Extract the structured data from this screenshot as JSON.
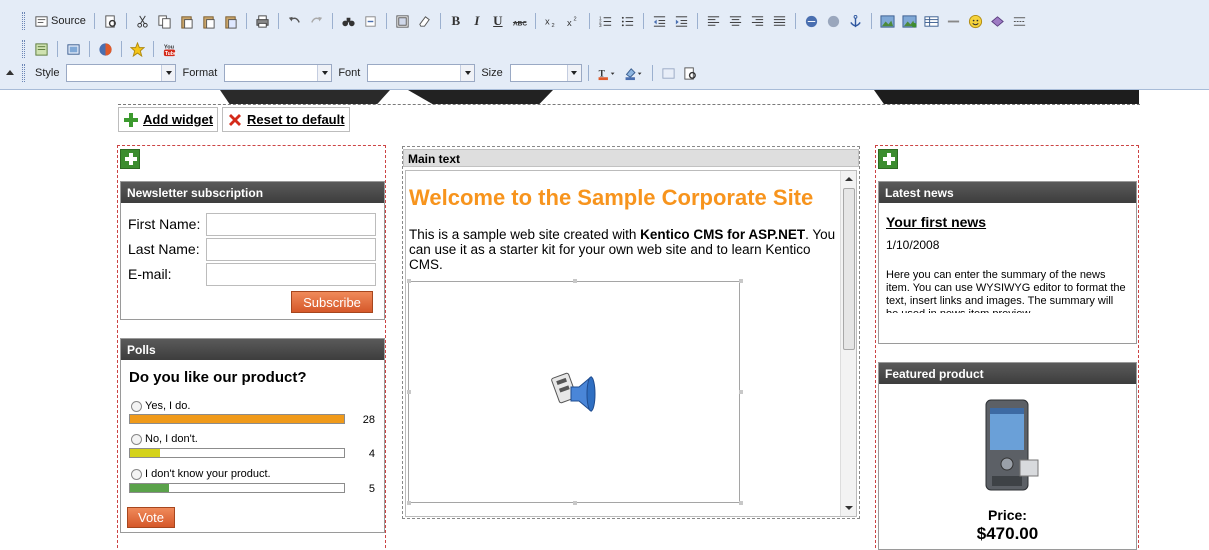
{
  "toolbar": {
    "source_label": "Source",
    "bold": "B",
    "italic": "I",
    "underline": "U",
    "style_label": "Style",
    "format_label": "Format",
    "font_label": "Font",
    "size_label": "Size"
  },
  "widgets": {
    "add_label": "Add widget",
    "reset_label": "Reset to default"
  },
  "newsletter": {
    "title": "Newsletter subscription",
    "first_name_label": "First Name:",
    "last_name_label": "Last Name:",
    "email_label": "E-mail:",
    "first_name_value": "",
    "last_name_value": "",
    "email_value": "",
    "subscribe_label": "Subscribe"
  },
  "polls": {
    "title": "Polls",
    "question": "Do you like our product?",
    "options": [
      {
        "label": "Yes, I do.",
        "count": "28",
        "fraction": 1.0,
        "color": "#f09a1a"
      },
      {
        "label": "No, I don't.",
        "count": "4",
        "fraction": 0.14,
        "color": "#d4d21a"
      },
      {
        "label": "I don't know your product.",
        "count": "5",
        "fraction": 0.18,
        "color": "#5aa24a"
      }
    ],
    "vote_label": "Vote"
  },
  "main_text": {
    "header": "Main text",
    "heading": "Welcome to the Sample Corporate Site",
    "para_before": "This is a sample web site created with ",
    "para_bold": "Kentico CMS for ASP.NET",
    "para_after": ". You can use it as a starter kit for your own web site and to learn Kentico CMS.",
    "heading_color": "#f7941d"
  },
  "latest_news": {
    "title": "Latest news",
    "item_title": "Your first news",
    "item_date": "1/10/2008",
    "item_summary": "Here you can enter the summary of the news item. You can use WYSIWYG editor to format the text, insert links and images. The summary will be used in news item preview"
  },
  "featured": {
    "title": "Featured product",
    "price_label": "Price:",
    "price_value": "$470.00"
  }
}
